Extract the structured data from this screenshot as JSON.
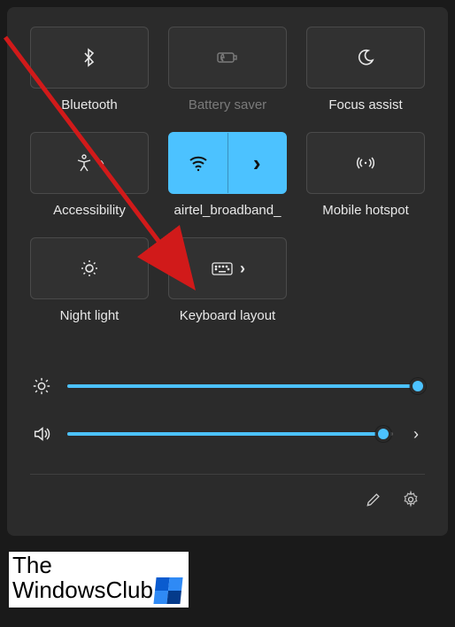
{
  "tiles": [
    {
      "id": "bluetooth",
      "label": "Bluetooth",
      "state": "off"
    },
    {
      "id": "battery-saver",
      "label": "Battery saver",
      "state": "disabled"
    },
    {
      "id": "focus-assist",
      "label": "Focus assist",
      "state": "off"
    },
    {
      "id": "accessibility",
      "label": "Accessibility",
      "state": "off",
      "has_flyout": true
    },
    {
      "id": "wifi",
      "label": "airtel_broadband_",
      "state": "active",
      "has_flyout": true
    },
    {
      "id": "mobile-hotspot",
      "label": "Mobile hotspot",
      "state": "off"
    },
    {
      "id": "night-light",
      "label": "Night light",
      "state": "off"
    },
    {
      "id": "keyboard-layout",
      "label": "Keyboard layout",
      "state": "off",
      "has_flyout": true
    }
  ],
  "sliders": {
    "brightness": {
      "value": 98
    },
    "volume": {
      "value": 97,
      "has_flyout": true
    }
  },
  "watermark": {
    "line1": "The",
    "line2": "WindowsClub"
  },
  "colors": {
    "accent": "#4cc2ff",
    "arrow": "#d11a1a"
  }
}
